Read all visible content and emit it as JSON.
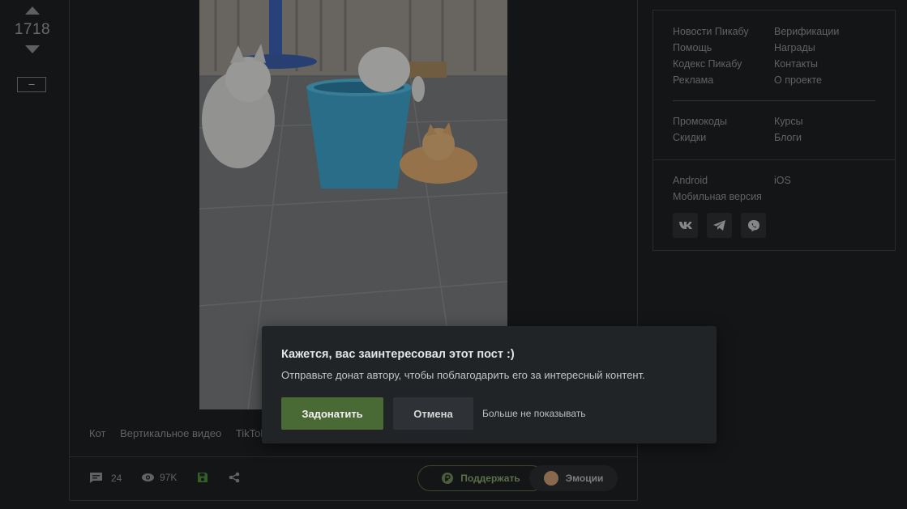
{
  "rating": {
    "score": "1718",
    "collapse_label": "–"
  },
  "story": {
    "tags": [
      "Кот",
      "Вертикальное видео",
      "TikTok"
    ],
    "footer": {
      "comments_count": "24",
      "views_count": "97K",
      "support_label": "Поддержать",
      "emotions_label": "Эмоции"
    }
  },
  "sidebar": {
    "links_col1": [
      "Новости Пикабу",
      "Помощь",
      "Кодекс Пикабу",
      "Реклама"
    ],
    "links_col2": [
      "Верификации",
      "Награды",
      "Контакты",
      "О проекте"
    ],
    "promo_col1": [
      "Промокоды",
      "Скидки"
    ],
    "promo_col2": [
      "Курсы",
      "Блоги"
    ],
    "apps_col1": [
      "Android",
      "Мобильная версия"
    ],
    "apps_col2": [
      "iOS"
    ],
    "social_icons": [
      "vk-icon",
      "telegram-icon",
      "viber-icon"
    ]
  },
  "popup": {
    "title": "Кажется, вас заинтересовал этот пост :)",
    "text": "Отправьте донат автору, чтобы поблагодарить его за интересный контент.",
    "donate_label": "Задонатить",
    "cancel_label": "Отмена",
    "never_label": "Больше не показывать"
  },
  "colors": {
    "background": "#1c1f22",
    "accent_green": "#4a6a35",
    "support_green": "#8aa46a"
  }
}
